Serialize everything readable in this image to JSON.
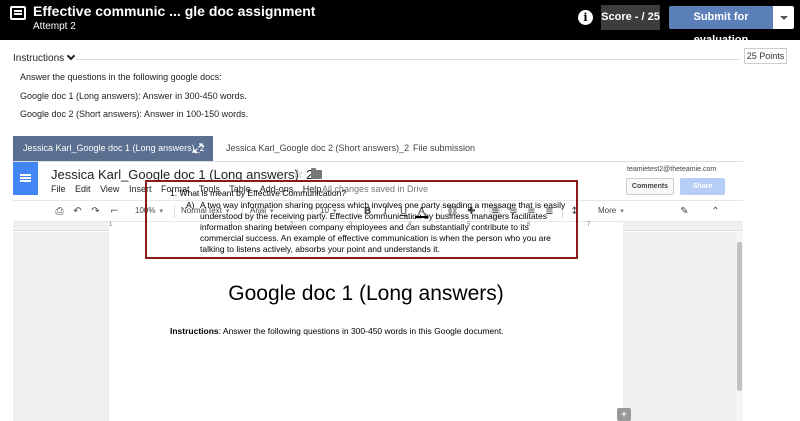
{
  "header": {
    "title": "Effective communic ... gle doc assignment",
    "subtitle": "Attempt 2",
    "score": "Score - / 25",
    "submit_label": "Submit for evaluation",
    "info_icon": "i"
  },
  "instructions": {
    "toggle_label": "Instructions",
    "points": "25 Points",
    "lines": [
      "Answer the questions in the following google docs:",
      "Google doc 1 (Long answers): Answer in 300-450 words.",
      "Google doc 2 (Short answers): Answer in 100-150 words."
    ]
  },
  "tabs": [
    {
      "label": "Jessica Karl_Google doc 1 (Long answers)_2",
      "active": true
    },
    {
      "label": "Jessica Karl_Google doc 2 (Short answers)_2",
      "active": false
    },
    {
      "label": "File submission",
      "active": false
    }
  ],
  "gdoc": {
    "title": "Jessica Karl_Google doc 1 (Long answers)_2",
    "menu": [
      "File",
      "Edit",
      "View",
      "Insert",
      "Format",
      "Tools",
      "Table",
      "Add-ons",
      "Help"
    ],
    "saved_status": "All changes saved in Drive",
    "user_email": "teamietest2@theteamie.com",
    "comments_label": "Comments",
    "share_label": "Share",
    "toolbar": {
      "zoom": "100%",
      "style": "Normal text",
      "font": "Arial",
      "size": "10",
      "more": "More"
    },
    "ruler_labels": [
      "1",
      "1",
      "2",
      "3",
      "4",
      "5",
      "6",
      "7"
    ],
    "doc": {
      "heading": "Google doc 1 (Long answers)",
      "intro_bold": "Instructions",
      "intro_rest": ": Answer the following questions in 300-450 words in this Google document.",
      "question": "1. What is meant by Effective Communication?",
      "answer_letter": "A)",
      "answer": "A two way information sharing process which involves one party sending a message that is easily understood by the receiving party. Effective communication by business managers facilitates information sharing between company employees and can substantially contribute to its commercial success. An example of effective communication is when the person who you are talking to listens actively, absorbs your point and understands it."
    }
  }
}
